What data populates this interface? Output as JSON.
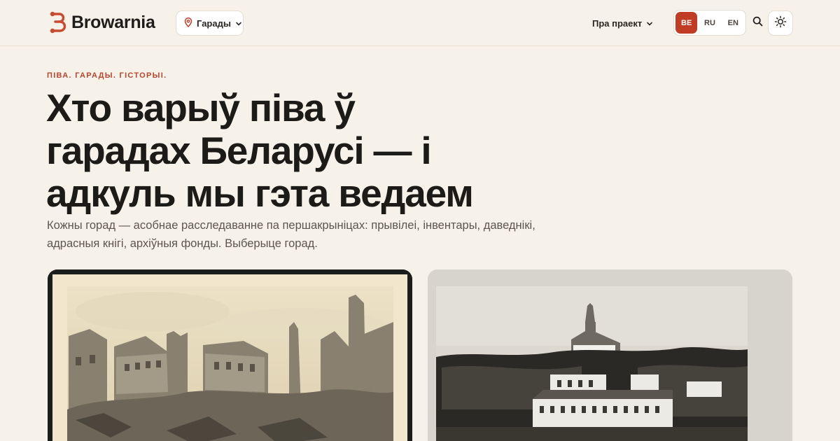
{
  "header": {
    "brand": "Browarnia",
    "city_menu_label": "Гарады",
    "about_label": "Пра праект",
    "languages": [
      {
        "code": "BE",
        "active": true
      },
      {
        "code": "RU",
        "active": false
      },
      {
        "code": "EN",
        "active": false
      }
    ]
  },
  "hero": {
    "eyebrow": "ПІВА. ГАРАДЫ. ГІСТОРЫІ.",
    "title_lines": [
      "Хто варыў піва ў",
      "гарадах Беларусі — і",
      "адкуль мы гэта ведаем"
    ],
    "lead_lines": [
      "Кожны горад — асобнае расследаванне па першакрыніцах: прывілеі, інвентары, даведнікі,",
      "адрасныя кнігі, архіўныя фонды. Выберыце горад."
    ]
  },
  "colors": {
    "accent": "#c13c25",
    "background": "#f6f2ea",
    "eyebrow": "#b8452e"
  },
  "icons": {
    "logo": "brand-mark-icon",
    "city": "map-pin-icon",
    "dropdown": "chevron-down-icon",
    "search": "search-icon",
    "theme": "sun-icon"
  }
}
